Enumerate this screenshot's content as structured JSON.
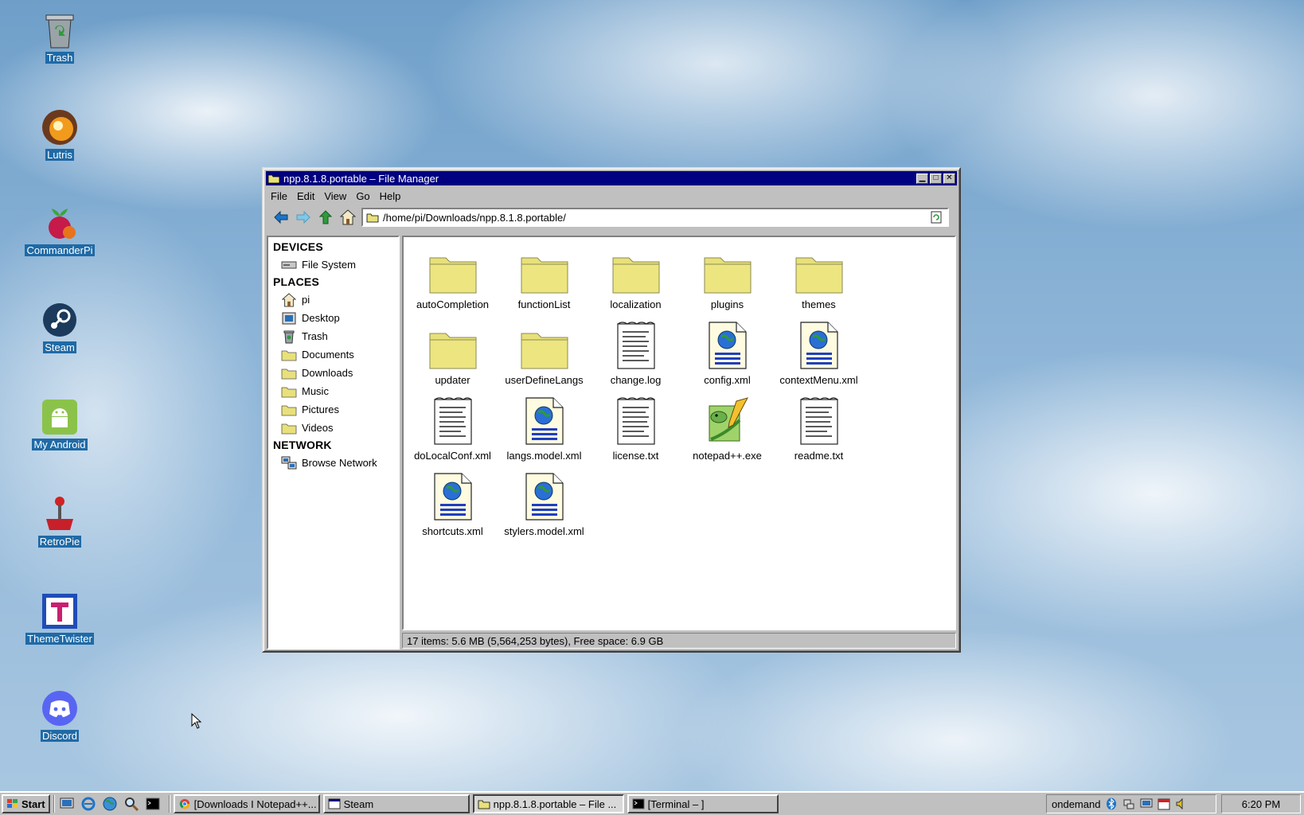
{
  "desktop": {
    "icons": [
      {
        "label": "Trash",
        "icon": "trash-icon"
      },
      {
        "label": "Lutris",
        "icon": "lutris-icon"
      },
      {
        "label": "CommanderPi",
        "icon": "raspberry-icon"
      },
      {
        "label": "Steam",
        "icon": "steam-icon"
      },
      {
        "label": "My Android",
        "icon": "android-icon"
      },
      {
        "label": "RetroPie",
        "icon": "joystick-icon"
      },
      {
        "label": "ThemeTwister",
        "icon": "themetwister-icon"
      },
      {
        "label": "Discord",
        "icon": "discord-icon"
      }
    ]
  },
  "window": {
    "title": "npp.8.1.8.portable – File Manager",
    "menu": [
      "File",
      "Edit",
      "View",
      "Go",
      "Help"
    ],
    "address": "/home/pi/Downloads/npp.8.1.8.portable/",
    "sidebar": {
      "devices_header": "DEVICES",
      "devices": [
        {
          "label": "File System",
          "icon": "drive-icon"
        }
      ],
      "places_header": "PLACES",
      "places": [
        {
          "label": "pi",
          "icon": "home-icon"
        },
        {
          "label": "Desktop",
          "icon": "desktop-icon"
        },
        {
          "label": "Trash",
          "icon": "trash-icon"
        },
        {
          "label": "Documents",
          "icon": "folder-icon"
        },
        {
          "label": "Downloads",
          "icon": "folder-icon"
        },
        {
          "label": "Music",
          "icon": "folder-icon"
        },
        {
          "label": "Pictures",
          "icon": "folder-icon"
        },
        {
          "label": "Videos",
          "icon": "folder-icon"
        }
      ],
      "network_header": "NETWORK",
      "network": [
        {
          "label": "Browse Network",
          "icon": "network-icon"
        }
      ]
    },
    "files": [
      {
        "name": "autoCompletion",
        "type": "folder"
      },
      {
        "name": "functionList",
        "type": "folder"
      },
      {
        "name": "localization",
        "type": "folder"
      },
      {
        "name": "plugins",
        "type": "folder"
      },
      {
        "name": "themes",
        "type": "folder"
      },
      {
        "name": "updater",
        "type": "folder"
      },
      {
        "name": "userDefineLangs",
        "type": "folder"
      },
      {
        "name": "change.log",
        "type": "text"
      },
      {
        "name": "config.xml",
        "type": "xml"
      },
      {
        "name": "contextMenu.xml",
        "type": "xml"
      },
      {
        "name": "doLocalConf.xml",
        "type": "text"
      },
      {
        "name": "langs.model.xml",
        "type": "xml"
      },
      {
        "name": "license.txt",
        "type": "text"
      },
      {
        "name": "notepad++.exe",
        "type": "exe"
      },
      {
        "name": "readme.txt",
        "type": "text"
      },
      {
        "name": "shortcuts.xml",
        "type": "xml"
      },
      {
        "name": "stylers.model.xml",
        "type": "xml"
      }
    ],
    "status": "17 items: 5.6 MB (5,564,253 bytes), Free space: 6.9 GB"
  },
  "taskbar": {
    "start_label": "Start",
    "tasks": [
      {
        "label": "[Downloads I Notepad++...",
        "icon": "chrome-icon",
        "active": false
      },
      {
        "label": "Steam",
        "icon": "window-icon",
        "active": false
      },
      {
        "label": "npp.8.1.8.portable – File ...",
        "icon": "folder-icon",
        "active": true
      },
      {
        "label": "[Terminal – ]",
        "icon": "terminal-icon",
        "active": false
      }
    ],
    "tray_label": "ondemand",
    "clock": "6:20 PM"
  },
  "colors": {
    "titlebar": "#000080",
    "folder": "#e8e07a",
    "desktop_label_bg": "#1f6aa6"
  }
}
